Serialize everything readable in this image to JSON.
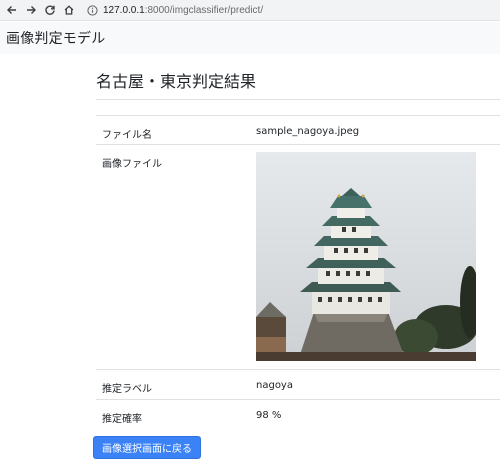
{
  "browser": {
    "url_host": "127.0.0.1",
    "url_rest": ":8000/imgclassifier/predict/"
  },
  "navbar": {
    "brand": "画像判定モデル"
  },
  "main": {
    "title": "名古屋・東京判定結果",
    "rows": [
      {
        "label": "ファイル名",
        "value": "sample_nagoya.jpeg"
      },
      {
        "label": "画像ファイル"
      },
      {
        "label": "推定ラベル",
        "value": "nagoya"
      },
      {
        "label": "推定確率",
        "value": "98 %"
      }
    ],
    "back_button": "画像選択画面に戻る"
  },
  "icons": {
    "back": "arrow-left-icon",
    "forward": "arrow-right-icon",
    "reload": "reload-icon",
    "home": "home-icon",
    "info": "info-icon"
  },
  "colors": {
    "button": "#3b82f6",
    "navbar_bg": "#f8f9fa"
  }
}
